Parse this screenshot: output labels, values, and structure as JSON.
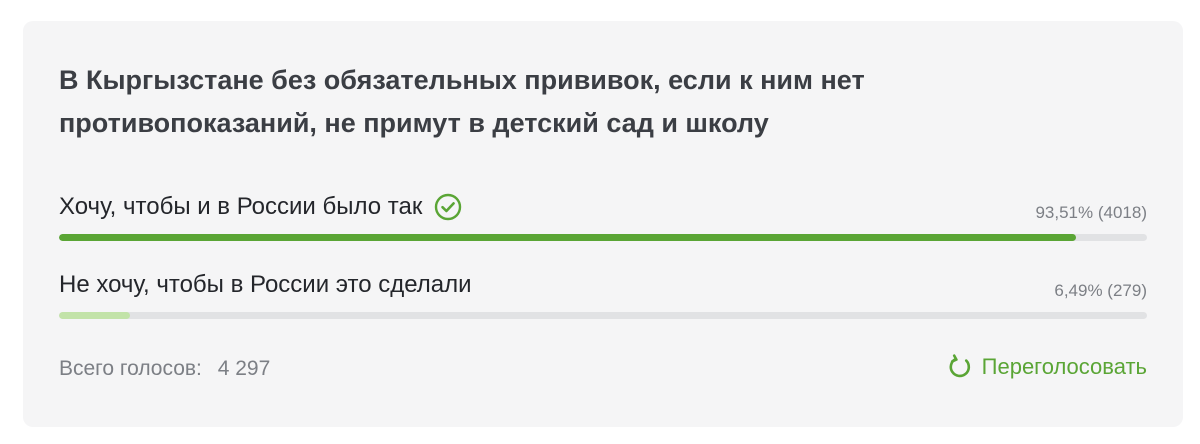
{
  "poll": {
    "question": "В Кыргызстане без обязательных прививок, если к ним нет противопоказаний, не примут в детский сад и школу",
    "options": [
      {
        "label": "Хочу, чтобы и в России было так",
        "stat": "93,51% (4018)",
        "percent": 93.51,
        "votes": 4018,
        "selected": true,
        "color": "#5aa535"
      },
      {
        "label": "Не хочу, чтобы в России это сделали",
        "stat": "6,49% (279)",
        "percent": 6.49,
        "votes": 279,
        "selected": false,
        "color": "#c2e3a8"
      }
    ],
    "total_label": "Всего голосов:",
    "total_value": "4 297",
    "revote_label": "Переголосовать",
    "accent_color": "#5aa535",
    "track_color": "#e1e2e4"
  }
}
